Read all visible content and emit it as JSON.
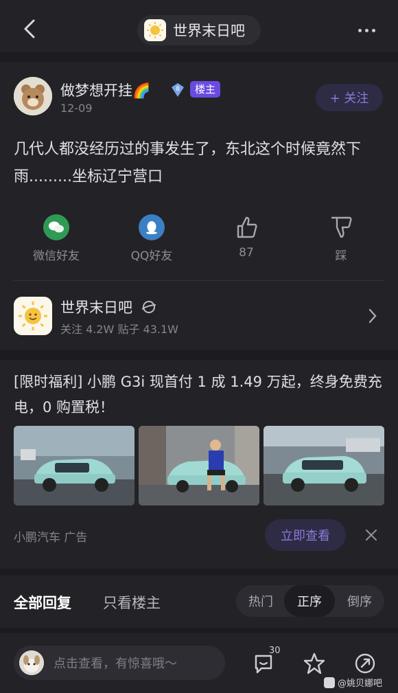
{
  "nav": {
    "forum_title": "世界末日吧"
  },
  "post": {
    "author": "做梦想开挂🌈",
    "level": "8",
    "owner_badge": "楼主",
    "date": "12-09",
    "follow_label": "+ 关注",
    "content": "几代人都没经历过的事发生了，东北这个时候竟然下雨.........坐标辽宁营口",
    "actions": [
      {
        "label": "微信好友",
        "icon": "wechat-icon"
      },
      {
        "label": "QQ好友",
        "icon": "qq-icon"
      },
      {
        "label": "87",
        "icon": "thumbs-up-icon"
      },
      {
        "label": "踩",
        "icon": "thumbs-down-icon"
      }
    ]
  },
  "forum": {
    "name": "世界末日吧",
    "stats": "关注 4.2W   贴子 43.1W"
  },
  "ad": {
    "text": "[限时福利] 小鹏 G3i 现首付 1 成 1.49 万起，终身免费充电，0 购置税！",
    "source": "小鹏汽车   广告",
    "cta": "立即查看"
  },
  "replies": {
    "tab_all": "全部回复",
    "tab_owner": "只看楼主",
    "sort_options": [
      "热门",
      "正序",
      "倒序"
    ],
    "sort_selected": "正序"
  },
  "bottom": {
    "placeholder": "点击查看，有惊喜哦～",
    "comment_count": "30",
    "watermark": "@姚贝娜吧"
  },
  "colors": {
    "background": "#1c1b20",
    "card": "#232227",
    "accent": "#8a7bd8",
    "badge": "#6a4be0"
  }
}
